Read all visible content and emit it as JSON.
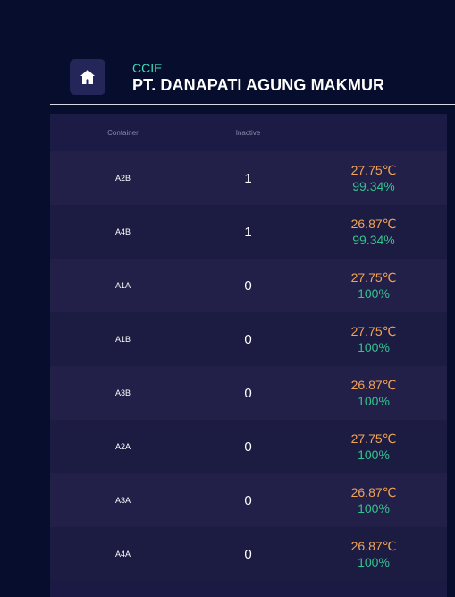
{
  "header": {
    "subtitle": "CCIE",
    "title": "PT. DANAPATI AGUNG MAKMUR",
    "home_icon": "home-icon"
  },
  "colors": {
    "background": "#070d2c",
    "accent": "#3fdcb7",
    "temperature": "#f3a456",
    "humidity": "#34c38f"
  },
  "table": {
    "columns": [
      "Container",
      "Inactive",
      ""
    ],
    "rows": [
      {
        "container": "A2B",
        "inactive": "1",
        "temperature": "27.75℃",
        "humidity": "99.34%"
      },
      {
        "container": "A4B",
        "inactive": "1",
        "temperature": "26.87℃",
        "humidity": "99.34%"
      },
      {
        "container": "A1A",
        "inactive": "0",
        "temperature": "27.75℃",
        "humidity": "100%"
      },
      {
        "container": "A1B",
        "inactive": "0",
        "temperature": "27.75℃",
        "humidity": "100%"
      },
      {
        "container": "A3B",
        "inactive": "0",
        "temperature": "26.87℃",
        "humidity": "100%"
      },
      {
        "container": "A2A",
        "inactive": "0",
        "temperature": "27.75℃",
        "humidity": "100%"
      },
      {
        "container": "A3A",
        "inactive": "0",
        "temperature": "26.87℃",
        "humidity": "100%"
      },
      {
        "container": "A4A",
        "inactive": "0",
        "temperature": "26.87℃",
        "humidity": "100%"
      }
    ]
  }
}
